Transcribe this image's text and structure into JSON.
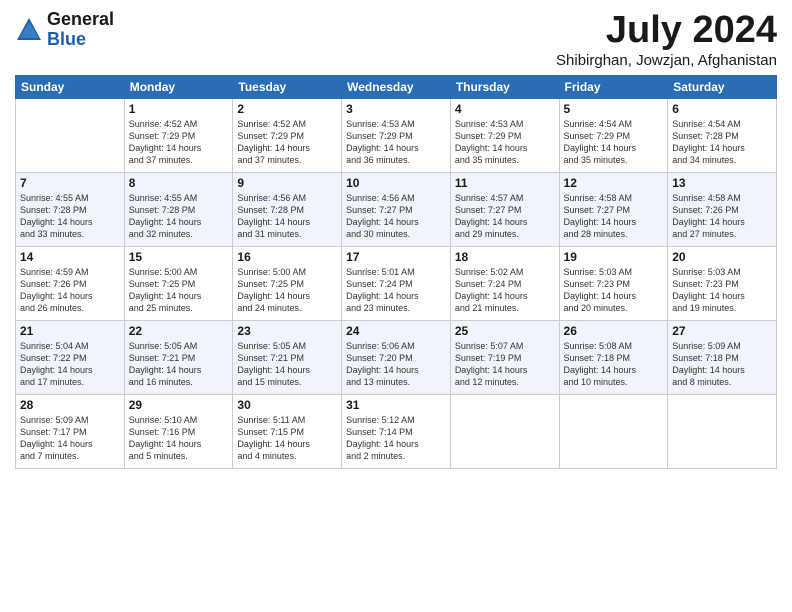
{
  "header": {
    "logo_general": "General",
    "logo_blue": "Blue",
    "month_year": "July 2024",
    "location": "Shibirghan, Jowzjan, Afghanistan"
  },
  "days_of_week": [
    "Sunday",
    "Monday",
    "Tuesday",
    "Wednesday",
    "Thursday",
    "Friday",
    "Saturday"
  ],
  "weeks": [
    [
      {
        "date": "",
        "info": ""
      },
      {
        "date": "1",
        "info": "Sunrise: 4:52 AM\nSunset: 7:29 PM\nDaylight: 14 hours\nand 37 minutes."
      },
      {
        "date": "2",
        "info": "Sunrise: 4:52 AM\nSunset: 7:29 PM\nDaylight: 14 hours\nand 37 minutes."
      },
      {
        "date": "3",
        "info": "Sunrise: 4:53 AM\nSunset: 7:29 PM\nDaylight: 14 hours\nand 36 minutes."
      },
      {
        "date": "4",
        "info": "Sunrise: 4:53 AM\nSunset: 7:29 PM\nDaylight: 14 hours\nand 35 minutes."
      },
      {
        "date": "5",
        "info": "Sunrise: 4:54 AM\nSunset: 7:29 PM\nDaylight: 14 hours\nand 35 minutes."
      },
      {
        "date": "6",
        "info": "Sunrise: 4:54 AM\nSunset: 7:28 PM\nDaylight: 14 hours\nand 34 minutes."
      }
    ],
    [
      {
        "date": "7",
        "info": "Sunrise: 4:55 AM\nSunset: 7:28 PM\nDaylight: 14 hours\nand 33 minutes."
      },
      {
        "date": "8",
        "info": "Sunrise: 4:55 AM\nSunset: 7:28 PM\nDaylight: 14 hours\nand 32 minutes."
      },
      {
        "date": "9",
        "info": "Sunrise: 4:56 AM\nSunset: 7:28 PM\nDaylight: 14 hours\nand 31 minutes."
      },
      {
        "date": "10",
        "info": "Sunrise: 4:56 AM\nSunset: 7:27 PM\nDaylight: 14 hours\nand 30 minutes."
      },
      {
        "date": "11",
        "info": "Sunrise: 4:57 AM\nSunset: 7:27 PM\nDaylight: 14 hours\nand 29 minutes."
      },
      {
        "date": "12",
        "info": "Sunrise: 4:58 AM\nSunset: 7:27 PM\nDaylight: 14 hours\nand 28 minutes."
      },
      {
        "date": "13",
        "info": "Sunrise: 4:58 AM\nSunset: 7:26 PM\nDaylight: 14 hours\nand 27 minutes."
      }
    ],
    [
      {
        "date": "14",
        "info": "Sunrise: 4:59 AM\nSunset: 7:26 PM\nDaylight: 14 hours\nand 26 minutes."
      },
      {
        "date": "15",
        "info": "Sunrise: 5:00 AM\nSunset: 7:25 PM\nDaylight: 14 hours\nand 25 minutes."
      },
      {
        "date": "16",
        "info": "Sunrise: 5:00 AM\nSunset: 7:25 PM\nDaylight: 14 hours\nand 24 minutes."
      },
      {
        "date": "17",
        "info": "Sunrise: 5:01 AM\nSunset: 7:24 PM\nDaylight: 14 hours\nand 23 minutes."
      },
      {
        "date": "18",
        "info": "Sunrise: 5:02 AM\nSunset: 7:24 PM\nDaylight: 14 hours\nand 21 minutes."
      },
      {
        "date": "19",
        "info": "Sunrise: 5:03 AM\nSunset: 7:23 PM\nDaylight: 14 hours\nand 20 minutes."
      },
      {
        "date": "20",
        "info": "Sunrise: 5:03 AM\nSunset: 7:23 PM\nDaylight: 14 hours\nand 19 minutes."
      }
    ],
    [
      {
        "date": "21",
        "info": "Sunrise: 5:04 AM\nSunset: 7:22 PM\nDaylight: 14 hours\nand 17 minutes."
      },
      {
        "date": "22",
        "info": "Sunrise: 5:05 AM\nSunset: 7:21 PM\nDaylight: 14 hours\nand 16 minutes."
      },
      {
        "date": "23",
        "info": "Sunrise: 5:05 AM\nSunset: 7:21 PM\nDaylight: 14 hours\nand 15 minutes."
      },
      {
        "date": "24",
        "info": "Sunrise: 5:06 AM\nSunset: 7:20 PM\nDaylight: 14 hours\nand 13 minutes."
      },
      {
        "date": "25",
        "info": "Sunrise: 5:07 AM\nSunset: 7:19 PM\nDaylight: 14 hours\nand 12 minutes."
      },
      {
        "date": "26",
        "info": "Sunrise: 5:08 AM\nSunset: 7:18 PM\nDaylight: 14 hours\nand 10 minutes."
      },
      {
        "date": "27",
        "info": "Sunrise: 5:09 AM\nSunset: 7:18 PM\nDaylight: 14 hours\nand 8 minutes."
      }
    ],
    [
      {
        "date": "28",
        "info": "Sunrise: 5:09 AM\nSunset: 7:17 PM\nDaylight: 14 hours\nand 7 minutes."
      },
      {
        "date": "29",
        "info": "Sunrise: 5:10 AM\nSunset: 7:16 PM\nDaylight: 14 hours\nand 5 minutes."
      },
      {
        "date": "30",
        "info": "Sunrise: 5:11 AM\nSunset: 7:15 PM\nDaylight: 14 hours\nand 4 minutes."
      },
      {
        "date": "31",
        "info": "Sunrise: 5:12 AM\nSunset: 7:14 PM\nDaylight: 14 hours\nand 2 minutes."
      },
      {
        "date": "",
        "info": ""
      },
      {
        "date": "",
        "info": ""
      },
      {
        "date": "",
        "info": ""
      }
    ]
  ]
}
